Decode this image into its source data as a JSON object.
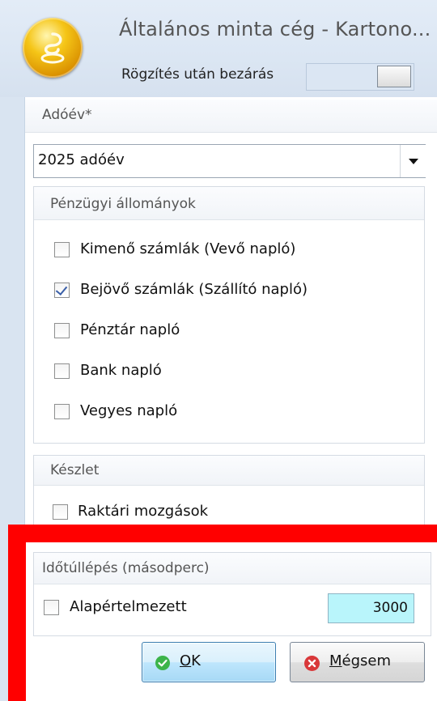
{
  "window": {
    "title": "Általános minta cég - Kartono...",
    "close_after_save_label": "Rögzítés után bezárás"
  },
  "tax_year": {
    "header": "Adóév*",
    "selected": "2025 adóév"
  },
  "financial": {
    "header": "Pénzügyi állományok",
    "items": [
      {
        "label": "Kimenő számlák (Vevő napló)",
        "checked": false
      },
      {
        "label": "Bejövő számlák (Szállító napló)",
        "checked": true
      },
      {
        "label": "Pénztár napló",
        "checked": false
      },
      {
        "label": "Bank napló",
        "checked": false
      },
      {
        "label": "Vegyes napló",
        "checked": false
      }
    ]
  },
  "stock": {
    "header": "Készlet",
    "item": {
      "label": "Raktári mozgások",
      "checked": false
    }
  },
  "timeout": {
    "header": "Időtúllépés (másodperc)",
    "default_label": "Alapértelmezett",
    "default_checked": false,
    "value": "3000"
  },
  "buttons": {
    "ok_underlined": "O",
    "ok_rest": "K",
    "cancel_underlined": "M",
    "cancel_rest": "égsem"
  },
  "colors": {
    "highlight": "#ff0000",
    "timeout_field": "#b9f5fb",
    "ok_icon": "#3cb44a",
    "cancel_icon": "#d9383a"
  }
}
